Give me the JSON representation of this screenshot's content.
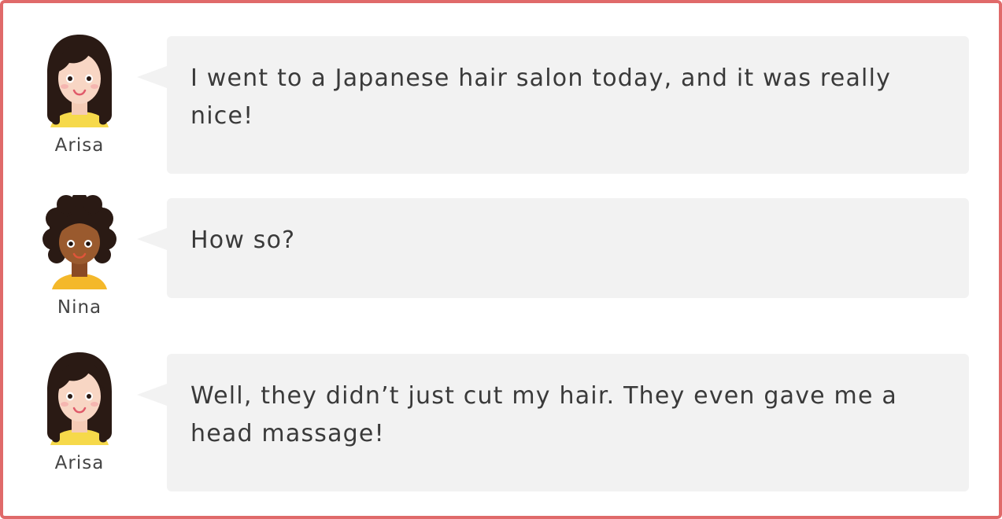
{
  "messages": [
    {
      "speaker": "Arisa",
      "text": "I went to a Japanese hair salon today, and it was really nice!",
      "avatar_icon": "arisa-avatar-icon"
    },
    {
      "speaker": "Nina",
      "text": "How so?",
      "avatar_icon": "nina-avatar-icon"
    },
    {
      "speaker": "Arisa",
      "text": "Well, they didn’t just cut my hair. They even gave me a head massage!",
      "avatar_icon": "arisa-avatar-icon"
    }
  ],
  "colors": {
    "frame_border": "#e06a6a",
    "bubble_bg": "#f2f2f2",
    "text": "#3a3a3a"
  }
}
